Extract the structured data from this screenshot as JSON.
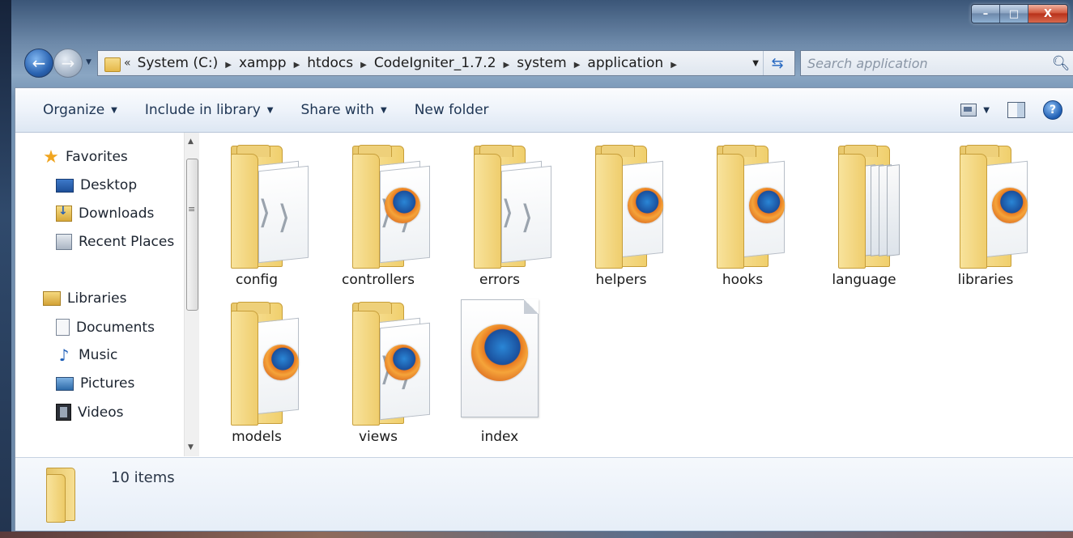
{
  "window": {
    "controls": {
      "minimize": "–",
      "maximize": "□",
      "close": "X"
    }
  },
  "navigation": {
    "back_icon": "back-arrow-icon",
    "forward_icon": "forward-arrow-icon",
    "address_prefix": "«",
    "breadcrumbs": [
      "System (C:)",
      "xampp",
      "htdocs",
      "CodeIgniter_1.7.2",
      "system",
      "application"
    ],
    "search_placeholder": "Search application"
  },
  "toolbar": {
    "organize": "Organize",
    "include_in_library": "Include in library",
    "share_with": "Share with",
    "new_folder": "New folder",
    "help": "?"
  },
  "sidebar": {
    "favorites": "Favorites",
    "favorites_items": [
      "Desktop",
      "Downloads",
      "Recent Places"
    ],
    "libraries": "Libraries",
    "libraries_items": [
      "Documents",
      "Music",
      "Pictures",
      "Videos"
    ]
  },
  "items": [
    {
      "name": "config",
      "kind": "folder-code"
    },
    {
      "name": "controllers",
      "kind": "folder-code-ff"
    },
    {
      "name": "errors",
      "kind": "folder-code"
    },
    {
      "name": "helpers",
      "kind": "folder-ff"
    },
    {
      "name": "hooks",
      "kind": "folder-ff"
    },
    {
      "name": "language",
      "kind": "folder-pages"
    },
    {
      "name": "libraries",
      "kind": "folder-ff"
    },
    {
      "name": "models",
      "kind": "folder-ff"
    },
    {
      "name": "views",
      "kind": "folder-code-ff"
    },
    {
      "name": "index",
      "kind": "file-firefox"
    }
  ],
  "details": {
    "item_count": "10 items"
  },
  "colors": {
    "folder": "#f0cf6c",
    "toolbar_text": "#1e3554",
    "accent": "#2a6bc2"
  }
}
